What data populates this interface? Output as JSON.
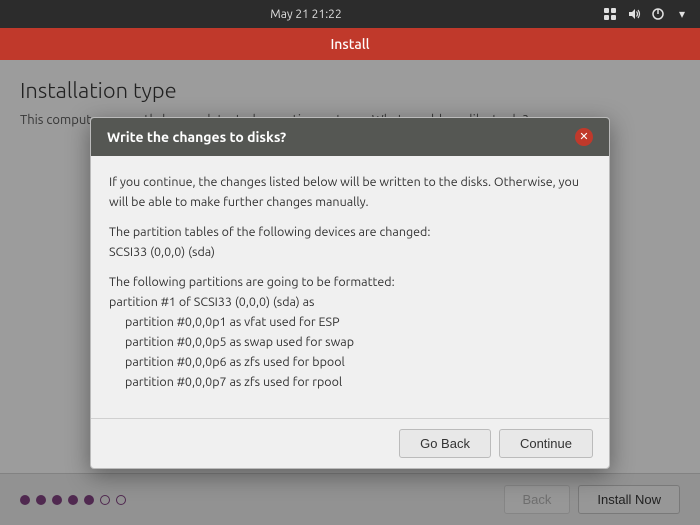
{
  "topbar": {
    "datetime": "May 21  21:22"
  },
  "titlebar": {
    "title": "Install"
  },
  "page": {
    "title": "Installation type",
    "subtitle": "This computer currently has no detected operating systems. What would you like to do?"
  },
  "modal": {
    "title": "Write the changes to disks?",
    "body_para1": "If you continue, the changes listed below will be written to the disks. Otherwise, you will be able to make further changes manually.",
    "body_para2": "The partition tables of the following devices are changed:",
    "body_device": "SCSI33 (0,0,0) (sda)",
    "body_para3": "The following partitions are going to be formatted:",
    "body_partition1": "partition #1 of SCSI33 (0,0,0) (sda) as",
    "body_partition2": "partition #0,0,0p1 as vfat used for ESP",
    "body_partition3": "partition #0,0,0p5 as swap used for swap",
    "body_partition4": "partition #0,0,0p6 as zfs used for bpool",
    "body_partition5": "partition #0,0,0p7 as zfs used for rpool",
    "go_back_label": "Go Back",
    "continue_label": "Continue"
  },
  "bottom": {
    "back_label": "Back",
    "install_label": "Install Now",
    "dots": [
      {
        "filled": true
      },
      {
        "filled": true
      },
      {
        "filled": true
      },
      {
        "filled": true
      },
      {
        "filled": true
      },
      {
        "filled": false
      },
      {
        "filled": false
      }
    ]
  },
  "icons": {
    "network": "⊞",
    "sound": "🔊",
    "power": "⏻",
    "close": "✕",
    "settings": "▾"
  }
}
